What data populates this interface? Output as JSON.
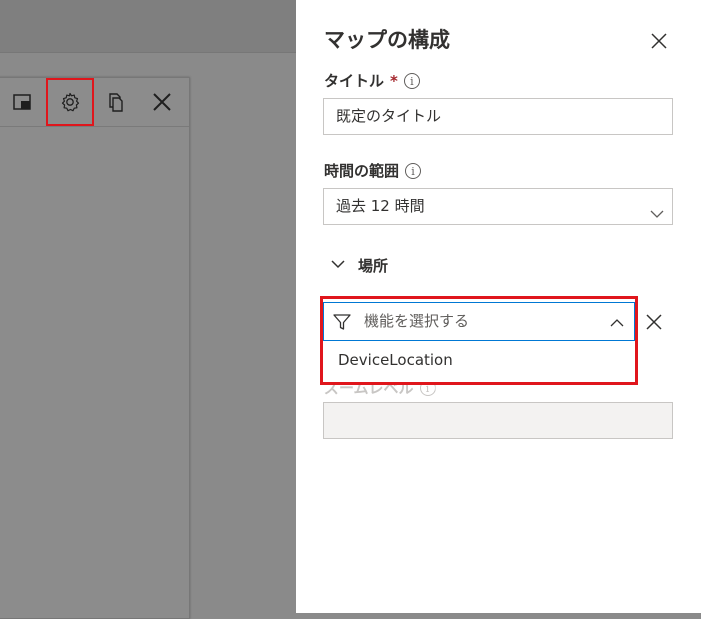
{
  "panel": {
    "title": "マップの構成",
    "title_field": {
      "label": "タイトル",
      "required_mark": "*",
      "info": "i",
      "value": "既定のタイトル"
    },
    "time_range": {
      "label": "時間の範囲",
      "info": "i",
      "value": "過去 12 時間"
    },
    "location_section": {
      "label": "場所",
      "feature_combo": {
        "placeholder": "機能を選択する",
        "options": [
          "DeviceLocation"
        ]
      }
    },
    "zoom_level": {
      "label": "ズームレベル",
      "info": "i",
      "value": ""
    }
  },
  "tile_toolbar": {
    "icons": [
      "unpin-icon",
      "gear-icon",
      "copy-icon",
      "close-icon"
    ],
    "highlighted": "gear-icon"
  },
  "colors": {
    "highlight_border": "#e0161c",
    "focus_border": "#0078d4",
    "overlay": "#8a8a8a"
  }
}
